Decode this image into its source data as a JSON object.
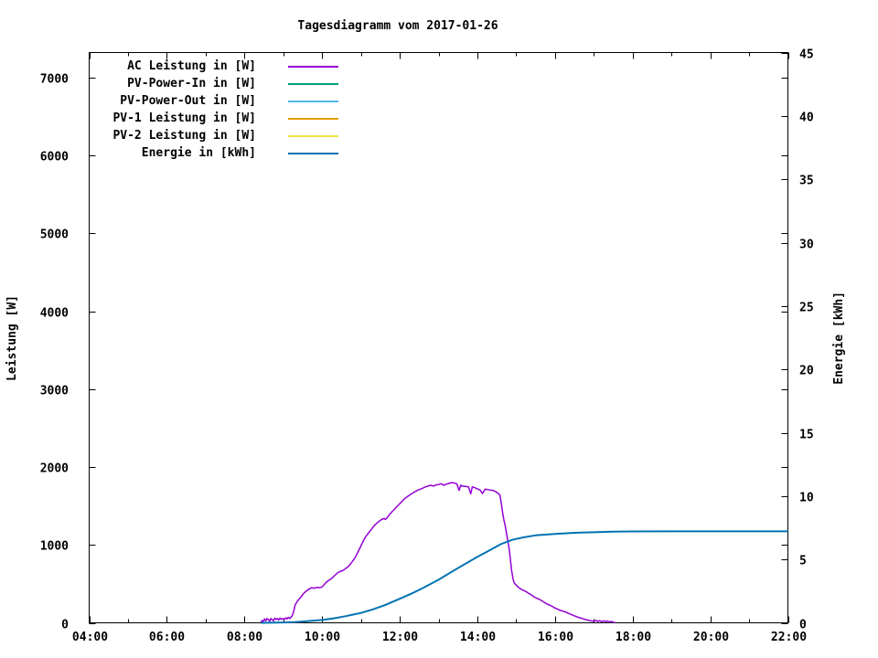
{
  "chart_data": {
    "type": "line",
    "title": "Tagesdiagramm vom 2017-01-26",
    "ylabel": "Leistung [W]",
    "y2label": "Energie [kWh]",
    "x_range": [
      4,
      22
    ],
    "y1_range": [
      0,
      7320
    ],
    "y2_range": [
      0,
      45
    ],
    "grid": false,
    "legend_position": "top-left-inside",
    "x_ticks": [
      {
        "h": 4,
        "label": "04:00"
      },
      {
        "h": 6,
        "label": "06:00"
      },
      {
        "h": 8,
        "label": "08:00"
      },
      {
        "h": 10,
        "label": "10:00"
      },
      {
        "h": 12,
        "label": "12:00"
      },
      {
        "h": 14,
        "label": "14:00"
      },
      {
        "h": 16,
        "label": "16:00"
      },
      {
        "h": 18,
        "label": "18:00"
      },
      {
        "h": 20,
        "label": "20:00"
      },
      {
        "h": 22,
        "label": "22:00"
      }
    ],
    "x_minor_hours": [
      5,
      7,
      9,
      11,
      13,
      15,
      17,
      19,
      21
    ],
    "y1_ticks": [
      {
        "v": 0,
        "label": "0"
      },
      {
        "v": 1000,
        "label": "1000"
      },
      {
        "v": 2000,
        "label": "2000"
      },
      {
        "v": 3000,
        "label": "3000"
      },
      {
        "v": 4000,
        "label": "4000"
      },
      {
        "v": 5000,
        "label": "5000"
      },
      {
        "v": 6000,
        "label": "6000"
      },
      {
        "v": 7000,
        "label": "7000"
      }
    ],
    "y2_ticks": [
      {
        "v": 0,
        "label": "0"
      },
      {
        "v": 5,
        "label": "5"
      },
      {
        "v": 10,
        "label": "10"
      },
      {
        "v": 15,
        "label": "15"
      },
      {
        "v": 20,
        "label": "20"
      },
      {
        "v": 25,
        "label": "25"
      },
      {
        "v": 30,
        "label": "30"
      },
      {
        "v": 35,
        "label": "35"
      },
      {
        "v": 40,
        "label": "40"
      },
      {
        "v": 45,
        "label": "45"
      }
    ],
    "series": [
      {
        "name": "AC Leistung in [W]",
        "color": "#9400d3",
        "axis": "y1",
        "width": 1.5,
        "points": [
          [
            8.43,
            5
          ],
          [
            8.45,
            30
          ],
          [
            8.48,
            15
          ],
          [
            8.52,
            50
          ],
          [
            8.55,
            25
          ],
          [
            8.58,
            55
          ],
          [
            8.62,
            40
          ],
          [
            8.65,
            20
          ],
          [
            8.68,
            55
          ],
          [
            8.72,
            40
          ],
          [
            8.75,
            25
          ],
          [
            8.78,
            60
          ],
          [
            8.82,
            45
          ],
          [
            8.85,
            55
          ],
          [
            8.88,
            35
          ],
          [
            8.92,
            60
          ],
          [
            8.95,
            45
          ],
          [
            9.0,
            55
          ],
          [
            9.03,
            45
          ],
          [
            9.07,
            65
          ],
          [
            9.1,
            50
          ],
          [
            9.13,
            70
          ],
          [
            9.17,
            55
          ],
          [
            9.2,
            75
          ],
          [
            9.23,
            90
          ],
          [
            9.27,
            150
          ],
          [
            9.3,
            220
          ],
          [
            9.33,
            250
          ],
          [
            9.37,
            280
          ],
          [
            9.42,
            310
          ],
          [
            9.47,
            340
          ],
          [
            9.53,
            380
          ],
          [
            9.6,
            410
          ],
          [
            9.67,
            435
          ],
          [
            9.73,
            450
          ],
          [
            9.8,
            445
          ],
          [
            9.87,
            455
          ],
          [
            9.93,
            450
          ],
          [
            10.0,
            460
          ],
          [
            10.07,
            500
          ],
          [
            10.13,
            530
          ],
          [
            10.2,
            555
          ],
          [
            10.27,
            580
          ],
          [
            10.33,
            610
          ],
          [
            10.4,
            640
          ],
          [
            10.47,
            660
          ],
          [
            10.53,
            670
          ],
          [
            10.6,
            695
          ],
          [
            10.67,
            720
          ],
          [
            10.73,
            755
          ],
          [
            10.8,
            800
          ],
          [
            10.87,
            855
          ],
          [
            10.93,
            915
          ],
          [
            11.0,
            985
          ],
          [
            11.07,
            1060
          ],
          [
            11.13,
            1110
          ],
          [
            11.2,
            1155
          ],
          [
            11.27,
            1200
          ],
          [
            11.33,
            1240
          ],
          [
            11.4,
            1275
          ],
          [
            11.47,
            1305
          ],
          [
            11.53,
            1325
          ],
          [
            11.6,
            1340
          ],
          [
            11.63,
            1325
          ],
          [
            11.67,
            1345
          ],
          [
            11.73,
            1385
          ],
          [
            11.8,
            1425
          ],
          [
            11.87,
            1460
          ],
          [
            11.93,
            1495
          ],
          [
            12.0,
            1530
          ],
          [
            12.07,
            1565
          ],
          [
            12.13,
            1595
          ],
          [
            12.2,
            1620
          ],
          [
            12.27,
            1645
          ],
          [
            12.33,
            1665
          ],
          [
            12.4,
            1685
          ],
          [
            12.47,
            1705
          ],
          [
            12.53,
            1715
          ],
          [
            12.6,
            1730
          ],
          [
            12.67,
            1745
          ],
          [
            12.73,
            1755
          ],
          [
            12.8,
            1765
          ],
          [
            12.87,
            1755
          ],
          [
            12.93,
            1770
          ],
          [
            13.0,
            1775
          ],
          [
            13.07,
            1785
          ],
          [
            13.13,
            1765
          ],
          [
            13.2,
            1780
          ],
          [
            13.27,
            1790
          ],
          [
            13.33,
            1800
          ],
          [
            13.4,
            1795
          ],
          [
            13.47,
            1785
          ],
          [
            13.53,
            1700
          ],
          [
            13.57,
            1765
          ],
          [
            13.63,
            1755
          ],
          [
            13.7,
            1750
          ],
          [
            13.77,
            1745
          ],
          [
            13.83,
            1655
          ],
          [
            13.87,
            1745
          ],
          [
            13.93,
            1735
          ],
          [
            14.0,
            1720
          ],
          [
            14.07,
            1705
          ],
          [
            14.13,
            1660
          ],
          [
            14.2,
            1715
          ],
          [
            14.27,
            1710
          ],
          [
            14.33,
            1705
          ],
          [
            14.4,
            1700
          ],
          [
            14.47,
            1685
          ],
          [
            14.53,
            1665
          ],
          [
            14.58,
            1640
          ],
          [
            14.62,
            1520
          ],
          [
            14.65,
            1420
          ],
          [
            14.68,
            1330
          ],
          [
            14.72,
            1240
          ],
          [
            14.75,
            1150
          ],
          [
            14.78,
            1060
          ],
          [
            14.82,
            950
          ],
          [
            14.85,
            820
          ],
          [
            14.88,
            680
          ],
          [
            14.92,
            560
          ],
          [
            14.95,
            510
          ],
          [
            15.0,
            485
          ],
          [
            15.07,
            450
          ],
          [
            15.13,
            430
          ],
          [
            15.2,
            415
          ],
          [
            15.27,
            395
          ],
          [
            15.33,
            375
          ],
          [
            15.4,
            355
          ],
          [
            15.47,
            330
          ],
          [
            15.53,
            315
          ],
          [
            15.6,
            300
          ],
          [
            15.67,
            280
          ],
          [
            15.73,
            260
          ],
          [
            15.8,
            240
          ],
          [
            15.87,
            225
          ],
          [
            15.93,
            210
          ],
          [
            16.0,
            190
          ],
          [
            16.07,
            175
          ],
          [
            16.13,
            160
          ],
          [
            16.2,
            150
          ],
          [
            16.27,
            140
          ],
          [
            16.33,
            125
          ],
          [
            16.4,
            110
          ],
          [
            16.47,
            95
          ],
          [
            16.53,
            85
          ],
          [
            16.6,
            70
          ],
          [
            16.67,
            60
          ],
          [
            16.73,
            50
          ],
          [
            16.8,
            40
          ],
          [
            16.87,
            30
          ],
          [
            16.93,
            25
          ],
          [
            17.0,
            20
          ],
          [
            17.05,
            32
          ],
          [
            17.1,
            18
          ],
          [
            17.15,
            28
          ],
          [
            17.2,
            14
          ],
          [
            17.25,
            26
          ],
          [
            17.3,
            16
          ],
          [
            17.35,
            24
          ],
          [
            17.4,
            10
          ],
          [
            17.45,
            18
          ],
          [
            17.5,
            8
          ],
          [
            17.55,
            4
          ]
        ]
      },
      {
        "name": "PV-Power-In in [W]",
        "color": "#009e73",
        "axis": "y1",
        "width": 1.5,
        "points": []
      },
      {
        "name": "PV-Power-Out in [W]",
        "color": "#56b4e9",
        "axis": "y1",
        "width": 1.5,
        "points": []
      },
      {
        "name": "PV-1 Leistung in [W]",
        "color": "#e69f00",
        "axis": "y1",
        "width": 1.5,
        "points": []
      },
      {
        "name": "PV-2 Leistung in [W]",
        "color": "#f0e442",
        "axis": "y1",
        "width": 1.5,
        "points": []
      },
      {
        "name": "Energie in [kWh]",
        "color": "#0072b2",
        "axis": "y2",
        "width": 2,
        "points": [
          [
            8.43,
            0
          ],
          [
            9.0,
            0.03
          ],
          [
            9.3,
            0.06
          ],
          [
            9.6,
            0.12
          ],
          [
            10.0,
            0.22
          ],
          [
            10.3,
            0.35
          ],
          [
            10.6,
            0.52
          ],
          [
            11.0,
            0.78
          ],
          [
            11.3,
            1.05
          ],
          [
            11.6,
            1.38
          ],
          [
            12.0,
            1.9
          ],
          [
            12.3,
            2.3
          ],
          [
            12.6,
            2.75
          ],
          [
            13.0,
            3.4
          ],
          [
            13.3,
            3.95
          ],
          [
            13.6,
            4.5
          ],
          [
            14.0,
            5.2
          ],
          [
            14.3,
            5.7
          ],
          [
            14.6,
            6.2
          ],
          [
            14.9,
            6.55
          ],
          [
            15.2,
            6.75
          ],
          [
            15.5,
            6.9
          ],
          [
            16.0,
            7.02
          ],
          [
            16.5,
            7.1
          ],
          [
            17.0,
            7.15
          ],
          [
            17.5,
            7.2
          ],
          [
            18.0,
            7.21
          ],
          [
            19.0,
            7.22
          ],
          [
            20.0,
            7.22
          ],
          [
            21.0,
            7.22
          ],
          [
            22.0,
            7.22
          ]
        ]
      }
    ]
  }
}
